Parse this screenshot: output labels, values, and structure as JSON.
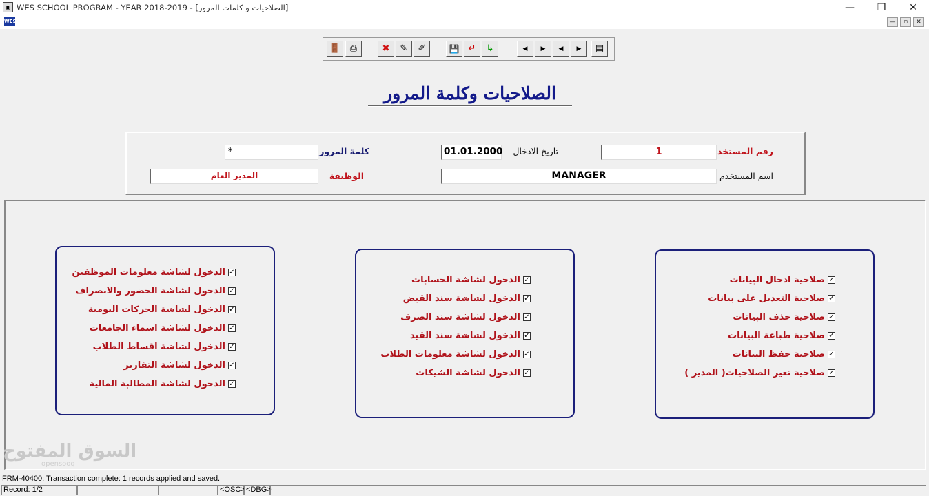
{
  "window": {
    "title": "WES SCHOOL PROGRAM - YEAR 2018-2019 - [الصلاحيات و كلمات المرور]",
    "app_icon": "oracle-forms-icon",
    "controls": {
      "minimize": "—",
      "restore": "❐",
      "close": "✕"
    },
    "mdi_controls": {
      "minimize": "—",
      "restore": "▫",
      "close": "✕"
    }
  },
  "toolbar": {
    "buttons": [
      {
        "name": "exit",
        "icon": "exit-door-icon",
        "glyph": "🚪"
      },
      {
        "name": "print",
        "icon": "print-icon",
        "glyph": "⎙"
      },
      {
        "name": "delete",
        "icon": "delete-icon",
        "glyph": "✖"
      },
      {
        "name": "edit",
        "icon": "edit-icon",
        "glyph": "✎"
      },
      {
        "name": "query",
        "icon": "query-icon",
        "glyph": "✐"
      },
      {
        "name": "save",
        "icon": "save-icon",
        "glyph": "💾"
      },
      {
        "name": "cancel",
        "icon": "cancel-record-icon",
        "glyph": "↵"
      },
      {
        "name": "add",
        "icon": "add-record-icon",
        "glyph": "↳"
      },
      {
        "name": "first",
        "icon": "first-record-icon",
        "glyph": "◀"
      },
      {
        "name": "next",
        "icon": "next-record-icon",
        "glyph": "▶"
      },
      {
        "name": "previous",
        "icon": "previous-record-icon",
        "glyph": "◀"
      },
      {
        "name": "last",
        "icon": "last-record-icon",
        "glyph": "▶"
      },
      {
        "name": "list",
        "icon": "list-values-icon",
        "glyph": "▤"
      }
    ]
  },
  "heading": "الصلاحيات وكلمة المرور",
  "header": {
    "user_no_label": "رقم المستخدم",
    "user_no_value": "1",
    "entry_date_label": "تاريخ الادخال",
    "entry_date_value": "01.01.2000",
    "password_label": "كلمة المرور",
    "password_value": "*",
    "user_name_label": "اسم المستخدم",
    "user_name_value": "MANAGER",
    "job_label": "الوظيفة",
    "job_value": "المدير العام"
  },
  "groups": {
    "data_permissions": [
      {
        "label": "صلاحية ادخال البيانات",
        "checked": true
      },
      {
        "label": "صلاحية التعديل على بيانات",
        "checked": true
      },
      {
        "label": "صلاحية حذف البيانات",
        "checked": true
      },
      {
        "label": "صلاحية طباعة البيانات",
        "checked": true
      },
      {
        "label": "صلاحية حفظ البيانات",
        "checked": true
      },
      {
        "label": "صلاحية تغير الصلاحيات( المدير )",
        "checked": true
      }
    ],
    "finance_screens": [
      {
        "label": "الدخول لشاشة الحسابات",
        "checked": true
      },
      {
        "label": "الدخول لشاشة سند القبض",
        "checked": true
      },
      {
        "label": "الدخول لشاشة سند الصرف",
        "checked": true
      },
      {
        "label": "الدخول لشاشة سند القيد",
        "checked": true
      },
      {
        "label": "الدخول لشاشة معلومات الطلاب",
        "checked": true
      },
      {
        "label": "الدخول لشاشة الشيكات",
        "checked": true
      }
    ],
    "admin_screens": [
      {
        "label": "الدخول لشاشة معلومات الموظفين",
        "checked": true
      },
      {
        "label": "الدخول لشاشة الحضور والانصراف",
        "checked": true
      },
      {
        "label": "الدخول لشاشة الحركات اليومية",
        "checked": true
      },
      {
        "label": "الدخول لشاشة اسماء الجامعات",
        "checked": true
      },
      {
        "label": "الدخول لشاشة اقساط الطلاب",
        "checked": true
      },
      {
        "label": "الدخول لشاشة التقارير",
        "checked": true
      },
      {
        "label": "الدخول لشاشة المطالبة المالية",
        "checked": true
      }
    ]
  },
  "watermark": "السوق المفتوح",
  "watermark_sub": "opensooq",
  "status": {
    "message": "FRM-40400: Transaction complete: 1 records applied and saved.",
    "record": "Record: 1/2",
    "osc": "<OSC>",
    "dbg": "<DBG>"
  }
}
